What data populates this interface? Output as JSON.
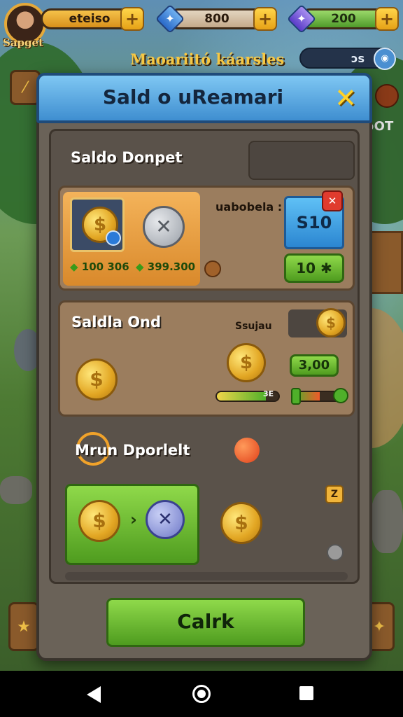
{
  "colors": {
    "accent": "#3f8ed0",
    "gold": "#e2a623",
    "green": "#4f9c1f"
  },
  "topbar": {
    "avatar_name": "Sapget",
    "currency1": "eteiso",
    "currency2": "800",
    "currency3": "200",
    "plus_label": "+"
  },
  "header": {
    "subtitle": "Maoariitó káarsles",
    "badge_value": "ɔs"
  },
  "side": {
    "right_label": "ɔOT"
  },
  "dialog": {
    "title": "Sald o uReamari",
    "close_label": "✕",
    "section1": {
      "title": "Saldo Donpet",
      "label": "uabobela :",
      "coin_left_amount": "100 306",
      "coin_right_amount": "399.300",
      "blue_button": "S10",
      "badge": "✕",
      "green_button": "10 ✱"
    },
    "section2": {
      "title": "Saldla Ond",
      "label": "Ssujau",
      "green_value": "3,00",
      "bar1_value": "3E",
      "bar1_level": 0.8,
      "bar2_level": 0.55
    },
    "section3": {
      "title": "Mrun Dporlelt",
      "arrow": "›",
      "small_badge": "Z"
    },
    "primary_button": "Calrk"
  },
  "icons": [
    "back-icon",
    "home-icon",
    "recent-apps-icon",
    "plus-icon",
    "close-icon",
    "coin-icon",
    "x-coin-icon",
    "gem-icon"
  ]
}
